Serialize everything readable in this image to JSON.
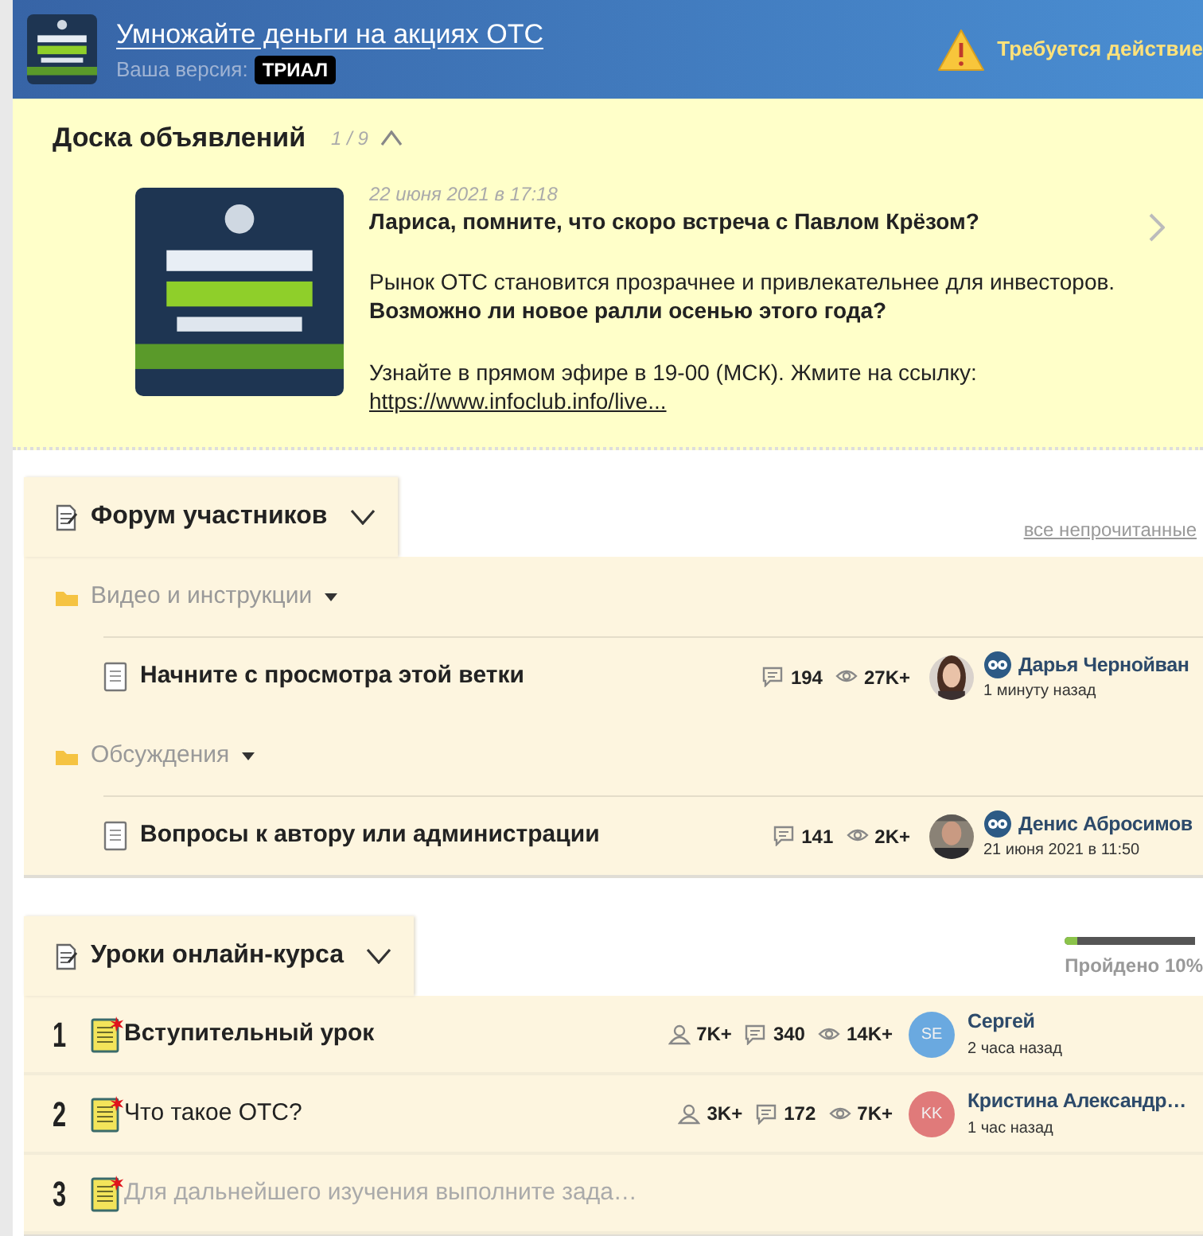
{
  "header": {
    "title": "Умножайте деньги на акциях ОТС",
    "version_label": "Ваша версия:",
    "version_badge": "ТРИАЛ",
    "alert": "Требуется действие"
  },
  "board": {
    "title": "Доска объявлений",
    "counter": "1 / 9",
    "expanded": true,
    "post": {
      "date": "22 июня 2021 в 17:18",
      "heading": "Лариса, помните, что скоро встреча с Павлом Крёзом?",
      "paragraphs": [
        "Рынок ОТС становится прозрачнее и привлекательнее для инвесторов. **Возможно ли новое ралли осенью этого года?**",
        "Узнайте в прямом эфире в 19-00 (МСК). Жмите на ссылку:"
      ],
      "link": "https://www.infoclub.info/live..."
    }
  },
  "forum": {
    "title": "Форум участников",
    "expanded": false,
    "unread_link": "все непрочитанные",
    "groups": [
      {
        "name": "Видео и инструкции",
        "topics": [
          {
            "title": "Начните с просмотра этой ветки",
            "comments": "194",
            "views": "27K+",
            "author": "Дарья Чернойван",
            "time": "1 минуту назад"
          }
        ]
      },
      {
        "name": "Обсуждения",
        "topics": [
          {
            "title": "Вопросы к автору или администрации",
            "comments": "141",
            "views": "2K+",
            "author": "Денис Абросимов",
            "time": "21 июня 2021 в 11:50"
          }
        ]
      }
    ]
  },
  "lessons": {
    "title": "Уроки онлайн-курса",
    "expanded": false,
    "progress": {
      "level": 0.1,
      "label": "Пройдено 10%"
    },
    "items": [
      {
        "number": "1",
        "title": "Вступительный урок",
        "unread": true,
        "disabled": false,
        "students": "7K+",
        "comments": "340",
        "views": "14K+",
        "initials": "SE",
        "color": "#6aa9e0",
        "author": "Сергей",
        "time": "2 часа назад"
      },
      {
        "number": "2",
        "title": "Что такое ОТС?",
        "unread": false,
        "disabled": false,
        "students": "3K+",
        "comments": "172",
        "views": "7K+",
        "initials": "KK",
        "color": "#e07a7a",
        "author": "Кристина Александр…",
        "time": "1 час назад"
      },
      {
        "number": "3",
        "title": "Для дальнейшего изучения выполните зада…",
        "unread": false,
        "disabled": true
      }
    ]
  }
}
